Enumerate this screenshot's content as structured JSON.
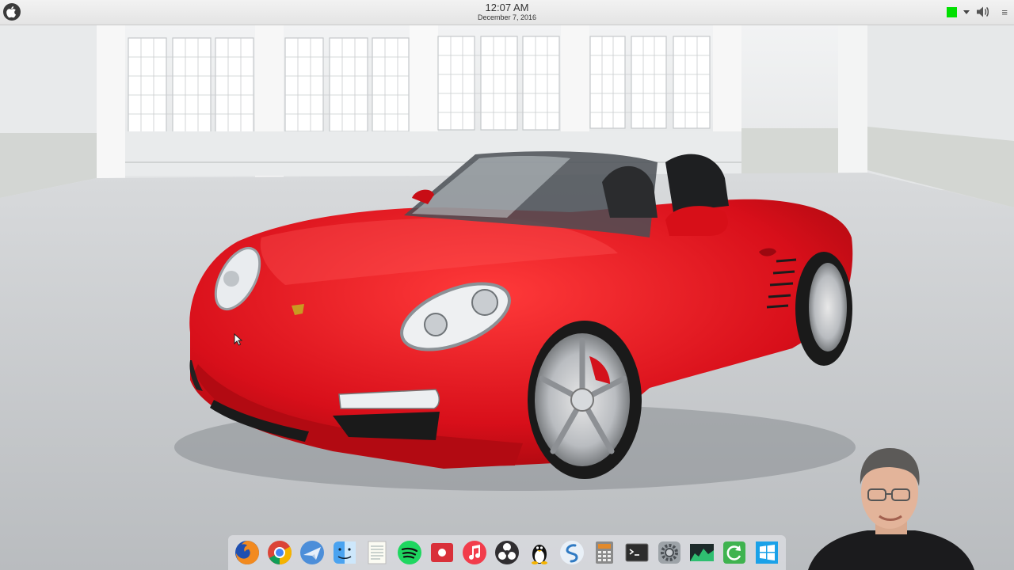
{
  "panel": {
    "time": "12:07 AM",
    "date": "December 7, 2016",
    "status_color": "#00e000",
    "icons": [
      "apple-icon",
      "green-status-icon",
      "chevron-down-icon",
      "volume-icon",
      "menu-icon"
    ],
    "menu_glyph": "≡"
  },
  "dock": {
    "apps": [
      {
        "name": "firefox",
        "icon": "firefox-icon"
      },
      {
        "name": "chrome",
        "icon": "chrome-icon"
      },
      {
        "name": "mail",
        "icon": "mail-icon"
      },
      {
        "name": "finder",
        "icon": "finder-icon"
      },
      {
        "name": "notes",
        "icon": "notes-icon"
      },
      {
        "name": "spotify",
        "icon": "spotify-icon"
      },
      {
        "name": "screen-recorder",
        "icon": "record-icon"
      },
      {
        "name": "music",
        "icon": "music-icon"
      },
      {
        "name": "obs",
        "icon": "obs-icon"
      },
      {
        "name": "linux",
        "icon": "tux-icon"
      },
      {
        "name": "simplenote",
        "icon": "simplenote-icon"
      },
      {
        "name": "calculator",
        "icon": "calculator-icon"
      },
      {
        "name": "terminal",
        "icon": "terminal-icon"
      },
      {
        "name": "system-settings",
        "icon": "gear-icon"
      },
      {
        "name": "system-monitor",
        "icon": "monitor-graph-icon"
      },
      {
        "name": "update-manager",
        "icon": "refresh-icon"
      },
      {
        "name": "windows",
        "icon": "windows-icon"
      }
    ]
  },
  "wallpaper": {
    "subject": "red-convertible-in-showroom",
    "car_color": "#e0101a"
  },
  "overlay": {
    "webcam": "presenter-webcam"
  }
}
